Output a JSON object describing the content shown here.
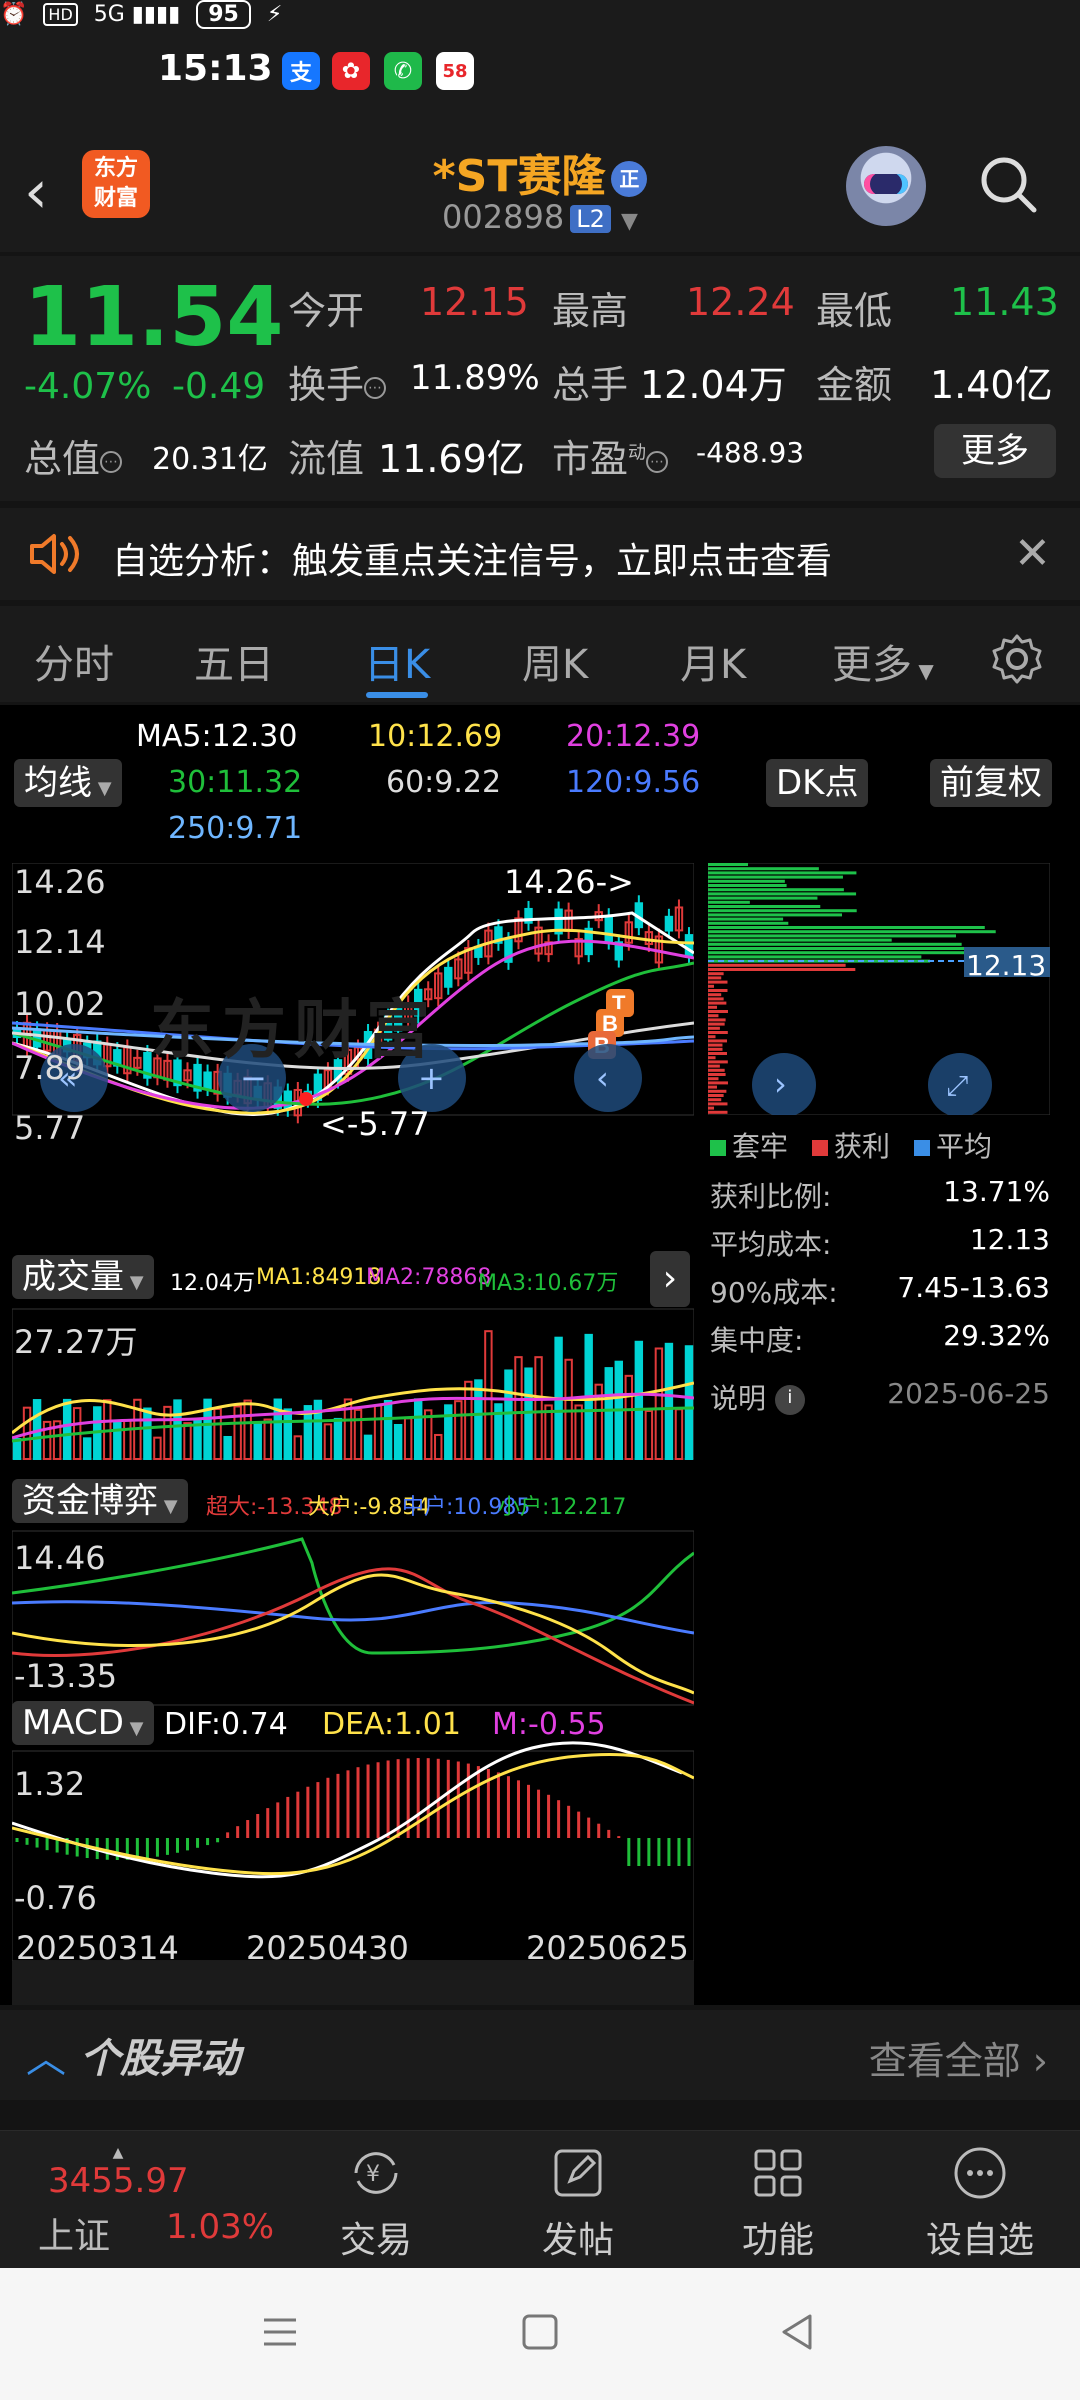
{
  "status": {
    "time": "15:13",
    "battery": "95",
    "app_badge_58": "58"
  },
  "header": {
    "logo_line1": "东方",
    "logo_line2": "财富",
    "name": "*ST赛隆",
    "badge": "正",
    "code": "002898",
    "level": "L2"
  },
  "quote": {
    "price": "11.54",
    "change_pct": "-4.07%",
    "change": "-0.49",
    "open_label": "今开",
    "open": "12.15",
    "high_label": "最高",
    "high": "12.24",
    "low_label": "最低",
    "low": "11.43",
    "turnover_label": "换手",
    "turnover": "11.89%",
    "volume_label": "总手",
    "volume": "12.04万",
    "amount_label": "金额",
    "amount": "1.40亿",
    "mktcap_label": "总值",
    "mktcap": "20.31亿",
    "float_label": "流值",
    "float": "11.69亿",
    "pe_label": "市盈",
    "pe_sup": "动",
    "pe": "-488.93",
    "more": "更多"
  },
  "notice": {
    "text": "自选分析：触发重点关注信号，立即点击查看"
  },
  "tabs": [
    "分时",
    "五日",
    "日K",
    "周K",
    "月K",
    "更多"
  ],
  "active_tab": "日K",
  "ma": {
    "selector": "均线",
    "ma5": "MA5:12.30",
    "ma10": "10:12.69",
    "ma20": "20:12.39",
    "ma30": "30:11.32",
    "ma60": "60:9.22",
    "ma120": "120:9.56",
    "ma250": "250:9.71",
    "dk": "DK点",
    "adjust": "前复权"
  },
  "kline": {
    "y_high": "14.26",
    "y_2": "12.14",
    "y_3": "10.02",
    "y_4": "7.89",
    "y_low": "5.77",
    "high_marker": "14.26->",
    "low_marker": "<-5.77",
    "watermark": "东方财富"
  },
  "volume": {
    "selector": "成交量",
    "vol": "12.04万",
    "ma1": "MA1:84918",
    "ma2": "MA2:78868",
    "ma3": "MA3:10.67万",
    "ymax": "27.27万"
  },
  "capital": {
    "selector": "资金博弈",
    "super": "超大:-13.348",
    "large": "大户:-9.854",
    "medium": "中户:10.985",
    "small": "小户:12.217",
    "ymax": "14.46",
    "ymin": "-13.35"
  },
  "macd": {
    "selector": "MACD",
    "dif": "DIF:0.74",
    "dea": "DEA:1.01",
    "m": "M:-0.55",
    "ymax": "1.32",
    "ymin": "-0.76",
    "dates": [
      "20250314",
      "20250430",
      "20250625"
    ]
  },
  "cost": {
    "price_tag": "12.13",
    "legend": [
      "套牢",
      "获利",
      "平均"
    ],
    "rows": [
      {
        "label": "获利比例:",
        "value": "13.71%"
      },
      {
        "label": "平均成本:",
        "value": "12.13"
      },
      {
        "label": "90%成本:",
        "value": "7.45-13.63"
      },
      {
        "label": "集中度:",
        "value": "29.32%"
      }
    ],
    "note_label": "说明",
    "date": "2025-06-25"
  },
  "section": {
    "title": "个股异动",
    "more": "查看全部"
  },
  "toolbar": {
    "index_value": "3455.97",
    "index_name": "上证",
    "index_change": "1.03%",
    "items": [
      "交易",
      "发帖",
      "功能",
      "设自选"
    ]
  },
  "colors": {
    "green": "#1ec14a",
    "red": "#e03a3a",
    "accent": "#3a8ee6",
    "ma5": "#ffffff",
    "ma10": "#ffe24a",
    "ma20": "#e040e0",
    "ma30": "#1fbf3a",
    "ma60": "#dddddd",
    "ma120": "#4a7bff",
    "ma250": "#6fb6ff"
  }
}
